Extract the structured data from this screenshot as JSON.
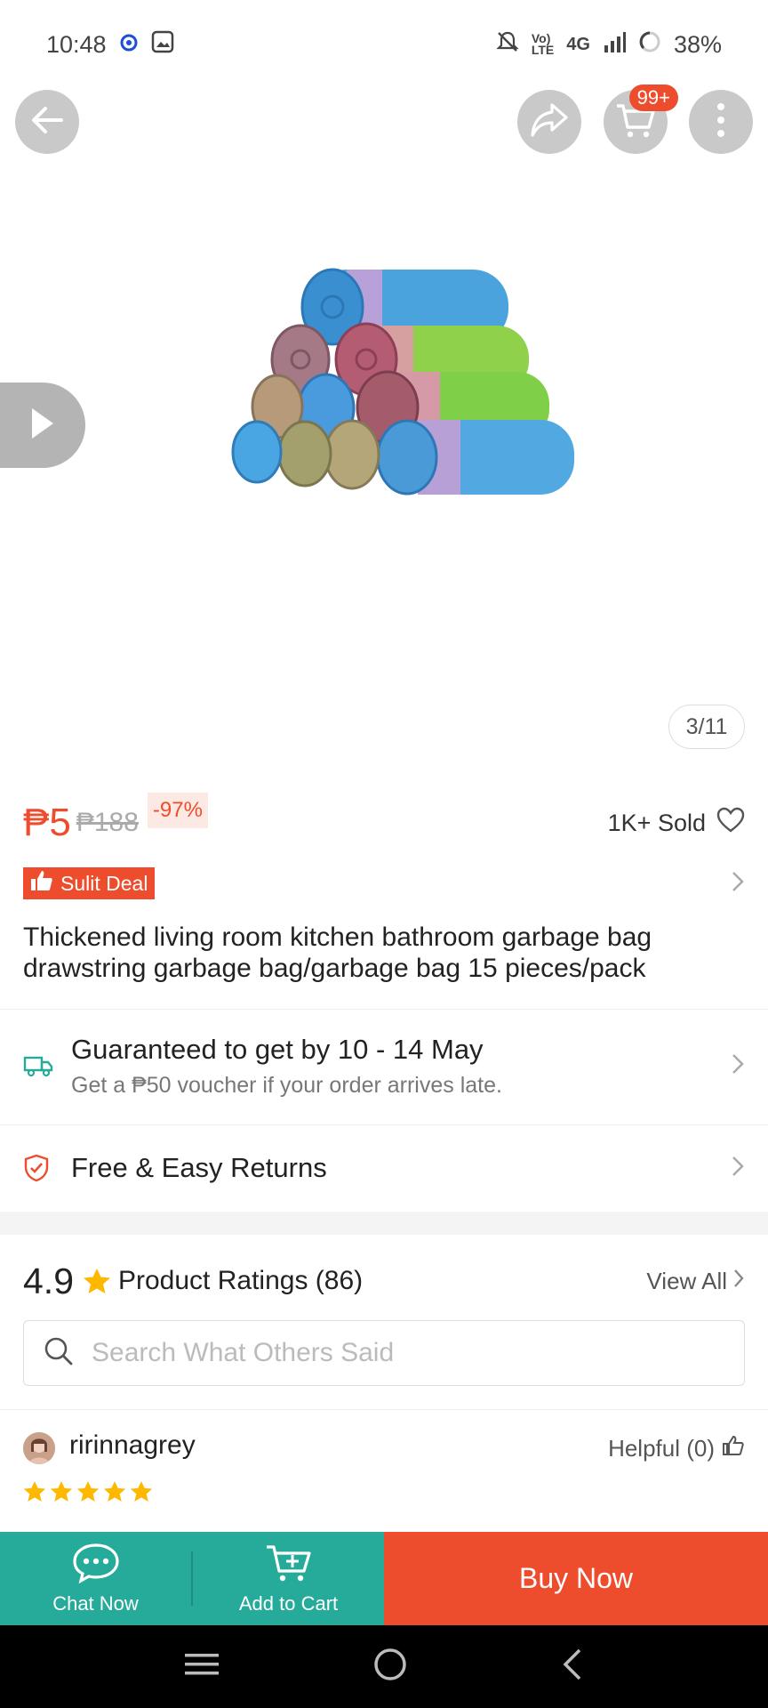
{
  "status_bar": {
    "time": "10:48",
    "battery": "38%",
    "network": "4G"
  },
  "header": {
    "cart_badge": "99+",
    "icons": [
      "back-arrow-icon",
      "share-icon",
      "cart-icon",
      "more-icon"
    ]
  },
  "gallery": {
    "counter": "3/11"
  },
  "product": {
    "price": "₱5",
    "original_price": "₱188",
    "discount": "-97%",
    "sold": "1K+ Sold",
    "deal_label": "Sulit Deal",
    "title": "Thickened living room kitchen bathroom garbage bag drawstring garbage bag/garbage bag 15 pieces/pack"
  },
  "shipping": {
    "title": "Guaranteed to get by 10 - 14 May",
    "subtitle": "Get a ₱50 voucher if your order arrives late."
  },
  "returns": {
    "label": "Free & Easy Returns"
  },
  "ratings": {
    "score": "4.9",
    "label": "Product Ratings (86)",
    "view_all": "View All",
    "search_placeholder": "Search What Others Said",
    "review": {
      "user": "ririnnagrey",
      "helpful": "Helpful (0)",
      "stars": 5
    }
  },
  "bottom_bar": {
    "chat": "Chat Now",
    "add_to_cart": "Add to Cart",
    "buy_now": "Buy Now"
  },
  "colors": {
    "accent": "#ee4d2d",
    "teal": "#26aa99"
  }
}
